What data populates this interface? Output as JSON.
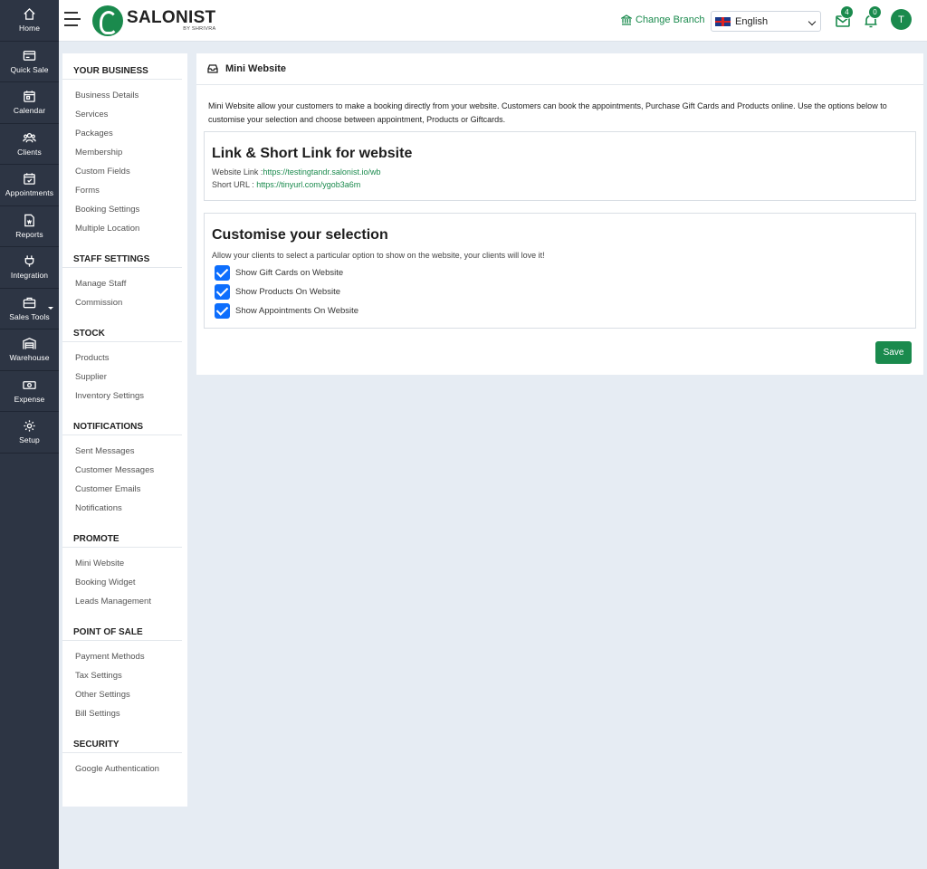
{
  "rail": [
    {
      "label": "Home",
      "icon": "home-icon"
    },
    {
      "label": "Quick Sale",
      "icon": "quick-sale-icon"
    },
    {
      "label": "Calendar",
      "icon": "calendar-icon"
    },
    {
      "label": "Clients",
      "icon": "clients-icon"
    },
    {
      "label": "Appointments",
      "icon": "appointments-icon"
    },
    {
      "label": "Reports",
      "icon": "reports-icon"
    },
    {
      "label": "Integration",
      "icon": "plug-icon"
    },
    {
      "label": "Sales Tools",
      "icon": "briefcase-icon"
    },
    {
      "label": "Warehouse",
      "icon": "warehouse-icon"
    },
    {
      "label": "Expense",
      "icon": "money-icon"
    },
    {
      "label": "Setup",
      "icon": "gear-icon"
    }
  ],
  "header": {
    "logo_name": "SALONIST",
    "logo_sub": "BY SHRIVRA",
    "change_branch": "Change Branch",
    "language": "English",
    "mail_count": "4",
    "notif_count": "0",
    "avatar_initial": "T"
  },
  "sidebar": {
    "sections": [
      {
        "title": "YOUR BUSINESS",
        "items": [
          "Business Details",
          "Services",
          "Packages",
          "Membership",
          "Custom Fields",
          "Forms",
          "Booking Settings",
          "Multiple Location"
        ]
      },
      {
        "title": "STAFF SETTINGS",
        "items": [
          "Manage Staff",
          "Commission"
        ]
      },
      {
        "title": "STOCK",
        "items": [
          "Products",
          "Supplier",
          "Inventory Settings"
        ]
      },
      {
        "title": "NOTIFICATIONS",
        "items": [
          "Sent Messages",
          "Customer Messages",
          "Customer Emails",
          "Notifications"
        ]
      },
      {
        "title": "PROMOTE",
        "items": [
          "Mini Website",
          "Booking Widget",
          "Leads Management"
        ]
      },
      {
        "title": "POINT OF SALE",
        "items": [
          "Payment Methods",
          "Tax Settings",
          "Other Settings",
          "Bill Settings"
        ]
      },
      {
        "title": "SECURITY",
        "items": [
          "Google Authentication"
        ]
      }
    ]
  },
  "main": {
    "title": "Mini Website",
    "intro": "Mini Website allow your customers to make a booking directly from your website. Customers can book the appointments, Purchase Gift Cards and Products online. Use the options below to customise your selection and choose between appointment, Products or Giftcards.",
    "links": {
      "heading": "Link & Short Link for website",
      "website_label": "Website Link :",
      "website_url": "https://testingtandr.salonist.io/wb",
      "short_label": "Short URL : ",
      "short_url": "https://tinyurl.com/ygob3a6m"
    },
    "customise": {
      "heading": "Customise your selection",
      "subtitle": "Allow your clients to select a particular option to show on the website, your clients will love it!",
      "options": [
        {
          "label": "Show Gift Cards on Website",
          "checked": true
        },
        {
          "label": "Show Products On Website",
          "checked": true
        },
        {
          "label": "Show Appointments On Website",
          "checked": true
        }
      ]
    },
    "save_label": "Save"
  },
  "colors": {
    "brand_green": "#1a8a4d",
    "rail_bg": "#2d3544",
    "checkbox_blue": "#0d6efd"
  }
}
